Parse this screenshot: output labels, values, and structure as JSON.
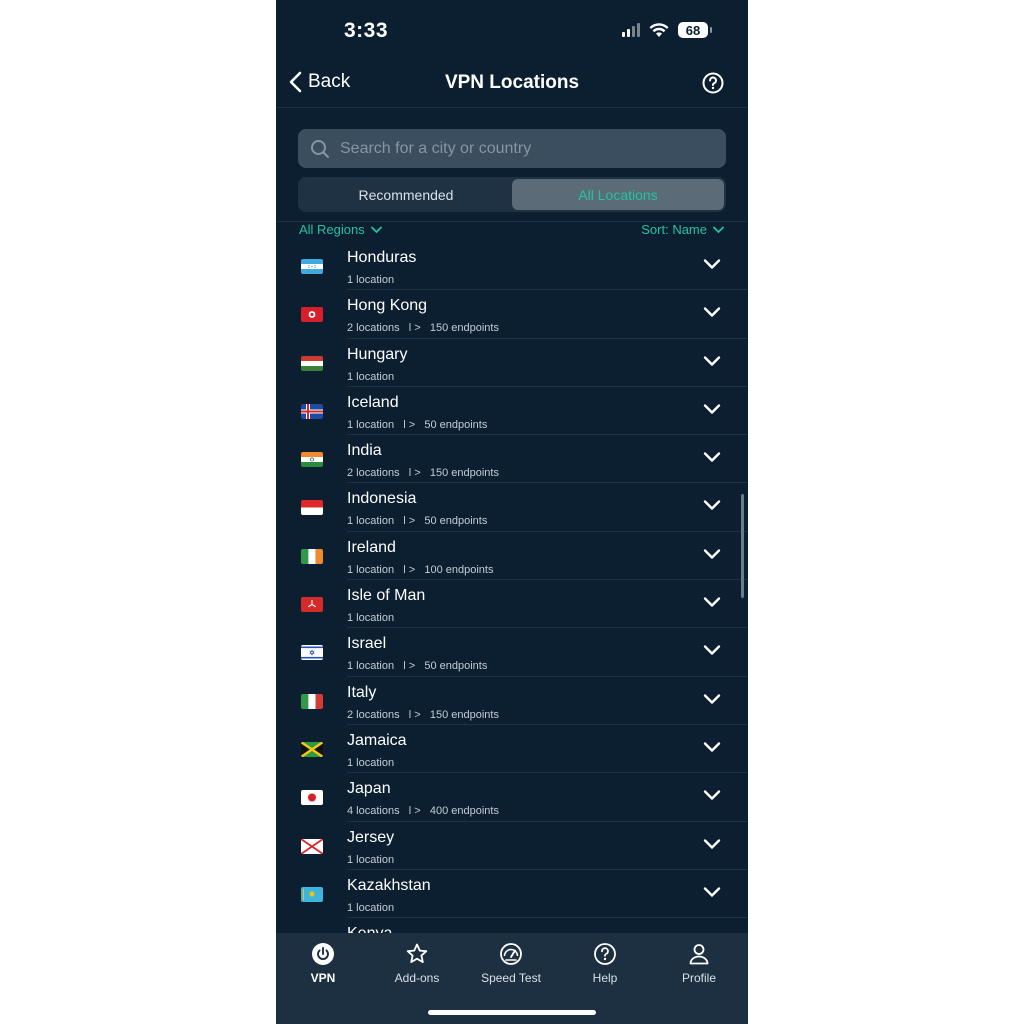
{
  "status_bar": {
    "time": "3:33",
    "battery": "68"
  },
  "header": {
    "back_label": "Back",
    "title": "VPN Locations"
  },
  "search": {
    "placeholder": "Search for a city or country"
  },
  "segments": {
    "recommended": "Recommended",
    "all_locations": "All Locations",
    "selected": "All Locations"
  },
  "filters": {
    "region": "All Regions",
    "sort": "Sort: Name"
  },
  "locations": [
    {
      "name": "Honduras",
      "meta": "1 location",
      "flag": "honduras"
    },
    {
      "name": "Hong Kong",
      "meta": "2 locations   l >   150 endpoints",
      "flag": "hong-kong"
    },
    {
      "name": "Hungary",
      "meta": "1 location",
      "flag": "hungary"
    },
    {
      "name": "Iceland",
      "meta": "1 location   l >   50 endpoints",
      "flag": "iceland"
    },
    {
      "name": "India",
      "meta": "2 locations   l >   150 endpoints",
      "flag": "india"
    },
    {
      "name": "Indonesia",
      "meta": "1 location   l >   50 endpoints",
      "flag": "indonesia"
    },
    {
      "name": "Ireland",
      "meta": "1 location   l >   100 endpoints",
      "flag": "ireland"
    },
    {
      "name": "Isle of Man",
      "meta": "1 location",
      "flag": "isle-of-man"
    },
    {
      "name": "Israel",
      "meta": "1 location   l >   50 endpoints",
      "flag": "israel"
    },
    {
      "name": "Italy",
      "meta": "2 locations   l >   150 endpoints",
      "flag": "italy"
    },
    {
      "name": "Jamaica",
      "meta": "1 location",
      "flag": "jamaica"
    },
    {
      "name": "Japan",
      "meta": "4 locations   l >   400 endpoints",
      "flag": "japan"
    },
    {
      "name": "Jersey",
      "meta": "1 location",
      "flag": "jersey"
    },
    {
      "name": "Kazakhstan",
      "meta": "1 location",
      "flag": "kazakhstan"
    }
  ],
  "partial_next": "Kenya",
  "tabbar": [
    {
      "label": "VPN",
      "icon": "power-icon",
      "active": true
    },
    {
      "label": "Add-ons",
      "icon": "star-icon",
      "active": false
    },
    {
      "label": "Speed Test",
      "icon": "speedometer-icon",
      "active": false
    },
    {
      "label": "Help",
      "icon": "help-icon",
      "active": false
    },
    {
      "label": "Profile",
      "icon": "person-icon",
      "active": false
    }
  ],
  "colors": {
    "background": "#0b1f31",
    "accent": "#26c2a0",
    "tabbar": "#1c3042",
    "search": "#3a4e5f"
  }
}
